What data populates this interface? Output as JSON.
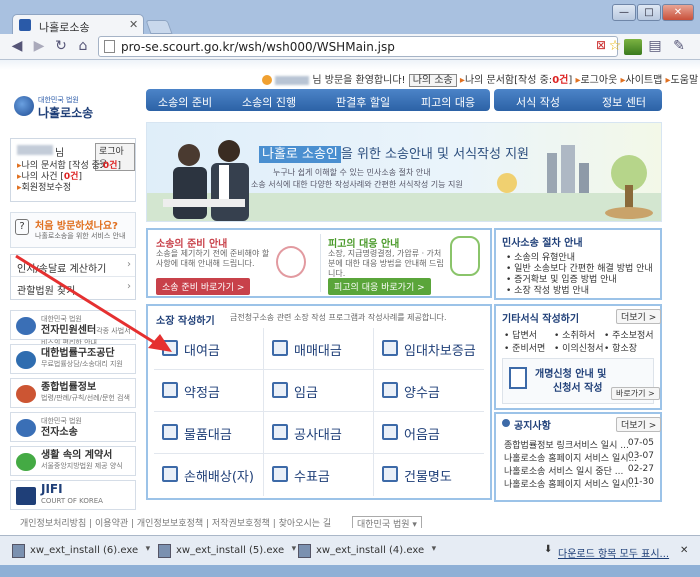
{
  "browser": {
    "tab_title": "나홀로소송",
    "url": "pro-se.scourt.go.kr/wsh/wsh000/WSHMain.jsp",
    "win_min": "—",
    "win_max": "□",
    "win_close": "✕"
  },
  "header": {
    "welcome": "님 방문을 환영합니다!",
    "my_case": "나의 소송",
    "my_docs": "나의 문서함",
    "saved_prefix": "[작성 중:",
    "saved_count": "0건",
    "saved_suffix": "]",
    "logout": "로그아웃",
    "sitemap": "사이트맵",
    "help": "도움말",
    "logo_small": "대한민국 법원",
    "logo_main": "나홀로소송",
    "nav_left": [
      "소송의 준비",
      "소송의 진행",
      "판결후 할일",
      "피고의 대응"
    ],
    "nav_right": [
      "서식 작성",
      "정보 센터"
    ]
  },
  "sidebar": {
    "user_suffix": "님",
    "logout": "로그아웃",
    "docs_label": "나의 문서함 [작성 중:",
    "docs_count": "0건",
    "cases_label": "나의 사건 [",
    "cases_count": "0건",
    "edit_profile": "회원정보수정",
    "first_visit_title": "처음 방문하셨나요?",
    "first_visit_desc": "나홀로소송을 위한 서비스 안내",
    "links": [
      "인지/송달료 계산하기",
      "관할법원 찾기"
    ],
    "banners": [
      {
        "title": "전자민원센터",
        "small": "대한민국 법원",
        "desc": "각종 사법서비스의 편리한 안내"
      },
      {
        "title": "대한법률구조공단",
        "small": "",
        "desc": "무료법률상담/소송대리 지원"
      },
      {
        "title": "종합법률정보",
        "small": "",
        "desc": "법령/판례/규칙/선례/문헌 검색"
      },
      {
        "title": "전자소송",
        "small": "대한민국 법원",
        "desc": ""
      },
      {
        "title": "생활 속의 계약서",
        "small": "",
        "desc": "서울중앙지방법원 제공 양식"
      },
      {
        "title": "JIFI",
        "small": "COURT OF KOREA",
        "desc": ""
      }
    ]
  },
  "hero": {
    "headline_prefix": "나홀로 소송인",
    "headline_suffix": "을 위한 소송안내 및 서식작성 지원",
    "desc1": "누구나 쉽게 이해할 수 있는 민사소송 절차 안내",
    "desc2": "소송 서식에 대한 다양한 작성사례와 간편한 서식작성 기능 지원"
  },
  "cards": {
    "prep_title": "소송의 준비 안내",
    "prep_desc": "소송을 제기하기 전에 준비해야 할 사항에 대해 안내해 드립니다.",
    "prep_btn": "소송 준비 바로가기 >",
    "def_title": "피고의 대응 안내",
    "def_desc": "소장, 지급명령결정, 가압류ㆍ가처분에 대한 대응 방법을 안내해 드립니다.",
    "def_btn": "피고의 대응 바로가기 >",
    "proc_title": "민사소송 절차 안내",
    "proc_items": [
      "소송의 유형안내",
      "일반 소송보다 간편한 해결 방법 안내",
      "증거확보 및 입증 방법 안내",
      "소장 작성 방법 안내"
    ]
  },
  "forms": {
    "title": "소장 작성하기",
    "desc": "금전청구소송 관련 소장 작성 프로그램과 작성사례를 제공합니다.",
    "items": [
      "대여금",
      "매매대금",
      "임대차보증금",
      "약정금",
      "임금",
      "양수금",
      "물품대금",
      "공사대금",
      "어음금",
      "손해배상(자)",
      "수표금",
      "건물명도"
    ]
  },
  "others": {
    "title": "기타서식 작성하기",
    "more": "더보기 >",
    "items": [
      "답변서",
      "소취하서",
      "주소보정서",
      "준비서면",
      "이의신청서",
      "항소장"
    ],
    "guide_line1": "개명신청 안내 및",
    "guide_line2": "신청서 작성",
    "go": "바로가기 >"
  },
  "notice": {
    "title": "공지사항",
    "more": "더보기 >",
    "items": [
      {
        "text": "종합법률정보 링크서비스 일시 ...",
        "date": "07-05"
      },
      {
        "text": "나홀로소송 홈페이지 서비스 일시...",
        "date": "03-07"
      },
      {
        "text": "나홀로소송 서비스 일시 중단 ...",
        "date": "02-27"
      },
      {
        "text": "나홀로소송 홈페이지 서비스 일시...",
        "date": "01-30"
      }
    ]
  },
  "footer": {
    "links": [
      "개인정보처리방침",
      "이용약관",
      "개인정보보호정책",
      "저작권보호정책",
      "찾아오시는 길"
    ],
    "select": "대한민국 법원"
  },
  "downloads": {
    "files": [
      "xw_ext_install (6).exe",
      "xw_ext_install (5).exe",
      "xw_ext_install (4).exe"
    ],
    "show_all": "다운로드 항목 모두 표시..."
  },
  "colors": {
    "accent": "#2c62a6",
    "red": "#c8414a",
    "green": "#5aa53a"
  }
}
